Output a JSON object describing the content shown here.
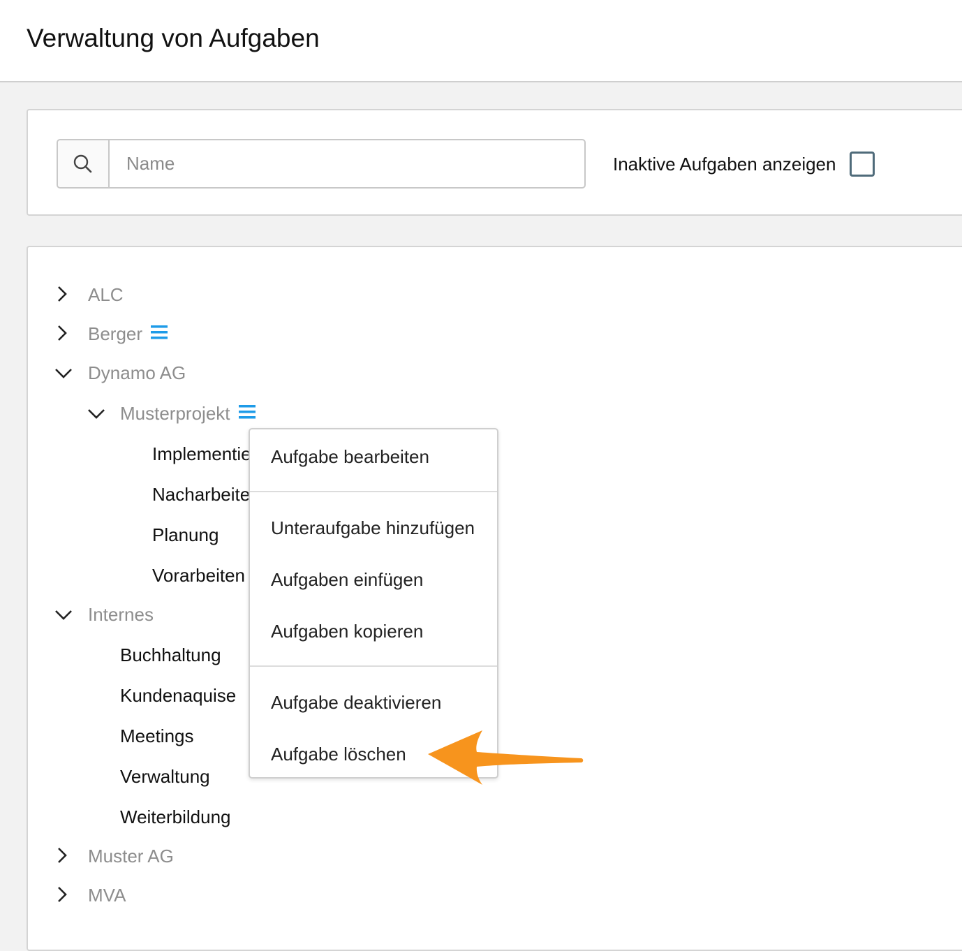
{
  "header": {
    "title": "Verwaltung von Aufgaben"
  },
  "filter": {
    "search_placeholder": "Name",
    "search_value": "",
    "inactive_label": "Inaktive Aufgaben anzeigen",
    "inactive_checked": false
  },
  "tree": {
    "alc": "ALC",
    "berger": "Berger",
    "dynamo": "Dynamo AG",
    "musterprojekt": "Musterprojekt",
    "musterprojekt_children": [
      "Implementie",
      "Nacharbeite",
      "Planung",
      "Vorarbeiten"
    ],
    "internes": "Internes",
    "internes_children": [
      "Buchhaltung",
      "Kundenaquise",
      "Meetings",
      "Verwaltung",
      "Weiterbildung"
    ],
    "muster_ag": "Muster AG",
    "mva": "MVA"
  },
  "context_menu": {
    "items": [
      "Aufgabe bearbeiten",
      "Unteraufgabe hinzufügen",
      "Aufgaben einfügen",
      "Aufgaben kopieren",
      "Aufgabe deaktivieren",
      "Aufgabe löschen"
    ]
  },
  "colors": {
    "accent": "#1e9be8",
    "arrow": "#f7941d",
    "group_text": "#8d8d8d",
    "checkbox_border": "#4f6b7a"
  },
  "icons": {
    "search": "search-icon",
    "collapsed": "chevron-right-icon",
    "expanded": "chevron-down-icon",
    "menu": "hamburger-menu-icon",
    "annotation": "arrow-pointer-icon"
  }
}
